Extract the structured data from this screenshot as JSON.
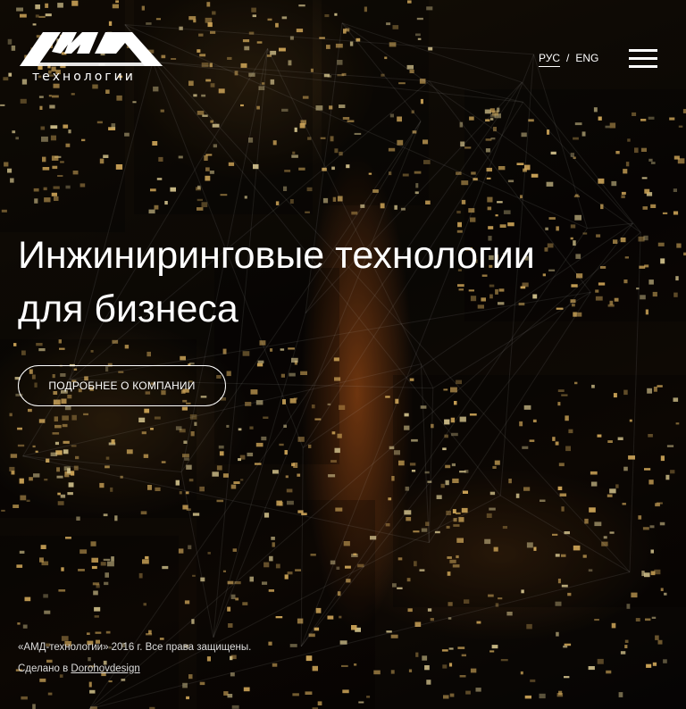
{
  "header": {
    "logo": {
      "mark": "AMD",
      "subtitle": "технологии"
    },
    "language": {
      "active": "РУС",
      "separator": "/",
      "other": "ENG"
    },
    "menu_icon": "hamburger-menu-icon"
  },
  "hero": {
    "headline_line1": "Инжиниринговые технологии",
    "headline_line2": "для бизнеса",
    "cta_label": "ПОДРОБНЕЕ О КОМПАНИИ",
    "background": "night-city-aerial-photo"
  },
  "footer": {
    "copyright": "«АМД-технологии» 2016 г. Все права защищены.",
    "made_by_prefix": "Сделано в",
    "made_by_link": "Dorohovdesign"
  },
  "colors": {
    "text": "#ffffff",
    "background": "#0b0907",
    "accent_glow": "#e86e1e"
  }
}
